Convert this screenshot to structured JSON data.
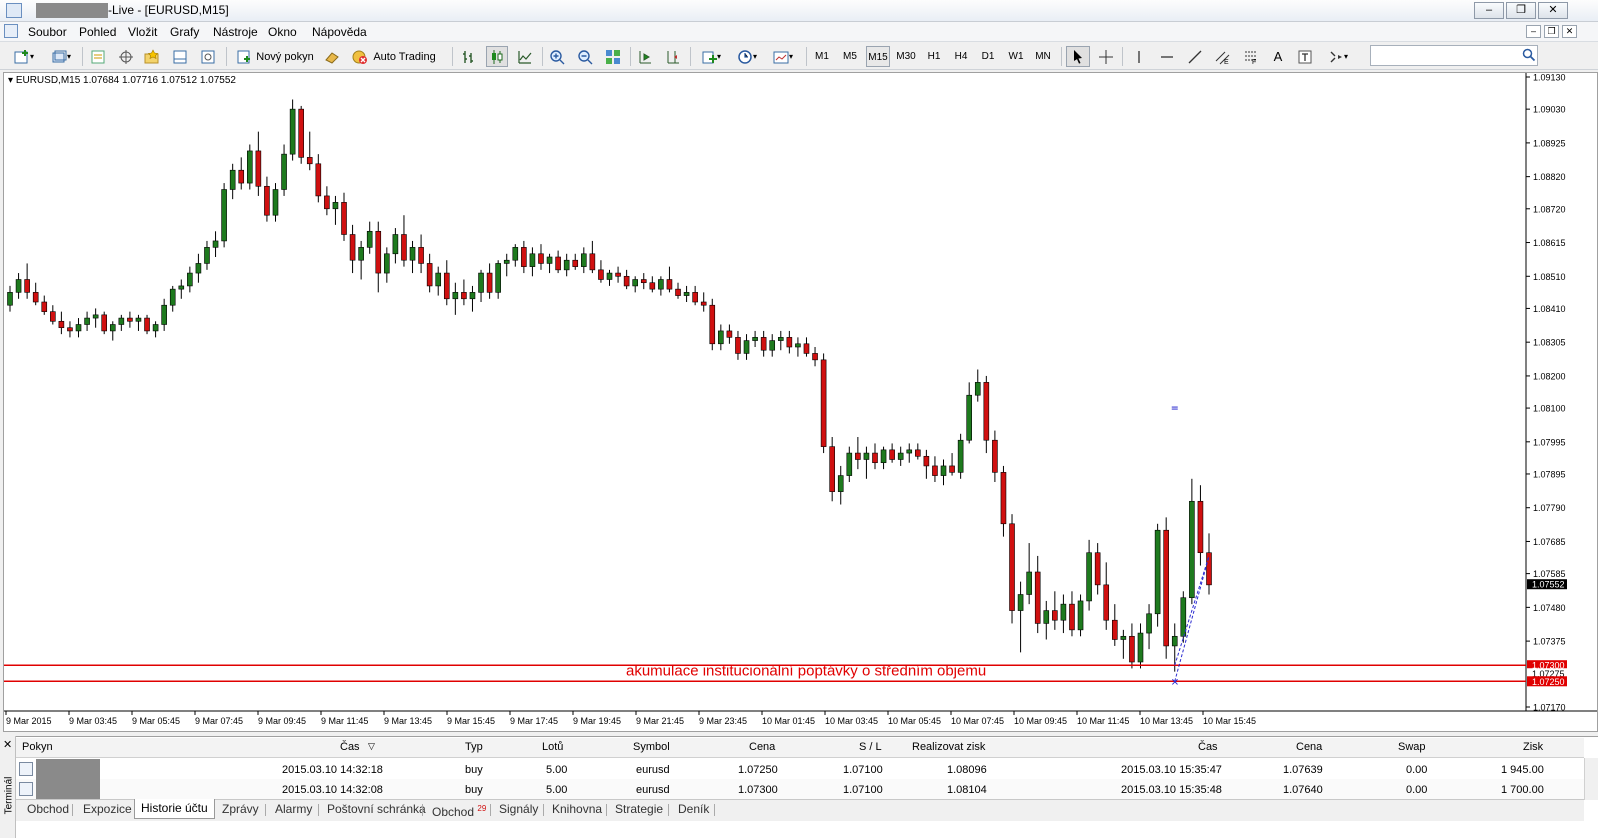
{
  "window": {
    "title": "-Live - [EURUSD,M15]",
    "buttons": [
      "–",
      "❐",
      "✕"
    ]
  },
  "menu": {
    "items": [
      "Soubor",
      "Pohled",
      "Vložit",
      "Grafy",
      "Nástroje",
      "Okno",
      "Nápověda"
    ]
  },
  "toolbar": {
    "new_order": "Nový pokyn",
    "auto_trading": "Auto Trading",
    "timeframes": [
      "M1",
      "M5",
      "M15",
      "M30",
      "H1",
      "H4",
      "D1",
      "W1",
      "MN"
    ],
    "active_timeframe": "M15",
    "text_tool": "A"
  },
  "chart": {
    "symbol_line": "EURUSD,M15  1.07684 1.07716 1.07512 1.07552",
    "annotation": "akumulace institucionální poptávky o středním objemu",
    "price_labels": [
      "1.09130",
      "1.09030",
      "1.08925",
      "1.08820",
      "1.08720",
      "1.08615",
      "1.08510",
      "1.08410",
      "1.08305",
      "1.08200",
      "1.08100",
      "1.07995",
      "1.07895",
      "1.07790",
      "1.07685",
      "1.07585",
      "1.07480",
      "1.07375",
      "1.07170"
    ],
    "current_price": "1.07552",
    "line_labels": [
      "1.07300",
      "1.07275",
      "1.07250"
    ],
    "time_labels": [
      "9 Mar 2015",
      "9 Mar 03:45",
      "9 Mar 05:45",
      "9 Mar 07:45",
      "9 Mar 09:45",
      "9 Mar 11:45",
      "9 Mar 13:45",
      "9 Mar 15:45",
      "9 Mar 17:45",
      "9 Mar 19:45",
      "9 Mar 21:45",
      "9 Mar 23:45",
      "10 Mar 01:45",
      "10 Mar 03:45",
      "10 Mar 05:45",
      "10 Mar 07:45",
      "10 Mar 09:45",
      "10 Mar 11:45",
      "10 Mar 13:45",
      "10 Mar 15:45"
    ],
    "colors": {
      "bull": "#1e7a1e",
      "bear": "#d01010",
      "line": "#e00000",
      "label_bg": "#e00000",
      "current_bg": "#000000"
    }
  },
  "chart_data": {
    "type": "candlestick",
    "symbol": "EURUSD",
    "timeframe": "M15",
    "ohlc": [
      [
        1.0842,
        1.0848,
        1.084,
        1.0846
      ],
      [
        1.0846,
        1.0852,
        1.0844,
        1.085
      ],
      [
        1.085,
        1.0855,
        1.0844,
        1.0846
      ],
      [
        1.0846,
        1.0849,
        1.0842,
        1.0843
      ],
      [
        1.0843,
        1.0845,
        1.0839,
        1.084
      ],
      [
        1.084,
        1.0842,
        1.0836,
        1.0837
      ],
      [
        1.0837,
        1.084,
        1.0833,
        1.0835
      ],
      [
        1.0835,
        1.0837,
        1.0832,
        1.0834
      ],
      [
        1.0834,
        1.0838,
        1.0832,
        1.0836
      ],
      [
        1.0836,
        1.084,
        1.0834,
        1.0838
      ],
      [
        1.0838,
        1.0841,
        1.0835,
        1.0839
      ],
      [
        1.0839,
        1.084,
        1.0833,
        1.0834
      ],
      [
        1.0834,
        1.0837,
        1.0831,
        1.0836
      ],
      [
        1.0836,
        1.0839,
        1.0834,
        1.0838
      ],
      [
        1.0838,
        1.084,
        1.0835,
        1.0837
      ],
      [
        1.0837,
        1.0839,
        1.0834,
        1.0838
      ],
      [
        1.0838,
        1.0839,
        1.0833,
        1.0834
      ],
      [
        1.0834,
        1.0837,
        1.0832,
        1.0836
      ],
      [
        1.0836,
        1.0844,
        1.0834,
        1.0842
      ],
      [
        1.0842,
        1.0848,
        1.084,
        1.0847
      ],
      [
        1.0847,
        1.085,
        1.0844,
        1.0848
      ],
      [
        1.0848,
        1.0854,
        1.0846,
        1.0852
      ],
      [
        1.0852,
        1.0858,
        1.0849,
        1.0855
      ],
      [
        1.0855,
        1.0862,
        1.0853,
        1.086
      ],
      [
        1.086,
        1.0865,
        1.0857,
        1.0862
      ],
      [
        1.0862,
        1.088,
        1.086,
        1.0878
      ],
      [
        1.0878,
        1.0886,
        1.0875,
        1.0884
      ],
      [
        1.0884,
        1.0888,
        1.0878,
        1.088
      ],
      [
        1.088,
        1.0892,
        1.0878,
        1.089
      ],
      [
        1.089,
        1.0896,
        1.0876,
        1.0879
      ],
      [
        1.0879,
        1.0882,
        1.0868,
        1.087
      ],
      [
        1.087,
        1.088,
        1.0868,
        1.0878
      ],
      [
        1.0878,
        1.0892,
        1.0876,
        1.0889
      ],
      [
        1.0889,
        1.0906,
        1.0887,
        1.0903
      ],
      [
        1.0903,
        1.0904,
        1.0886,
        1.0888
      ],
      [
        1.0888,
        1.0896,
        1.0884,
        1.0886
      ],
      [
        1.0886,
        1.0889,
        1.0874,
        1.0876
      ],
      [
        1.0876,
        1.0879,
        1.087,
        1.0872
      ],
      [
        1.0872,
        1.0876,
        1.0867,
        1.0874
      ],
      [
        1.0874,
        1.0877,
        1.0862,
        1.0864
      ],
      [
        1.0864,
        1.0867,
        1.0852,
        1.0856
      ],
      [
        1.0856,
        1.0862,
        1.085,
        1.086
      ],
      [
        1.086,
        1.0868,
        1.0858,
        1.0865
      ],
      [
        1.0865,
        1.0868,
        1.0846,
        1.0852
      ],
      [
        1.0852,
        1.086,
        1.0849,
        1.0858
      ],
      [
        1.0858,
        1.0866,
        1.0855,
        1.0864
      ],
      [
        1.0864,
        1.087,
        1.0854,
        1.0856
      ],
      [
        1.0856,
        1.0862,
        1.0852,
        1.086
      ],
      [
        1.086,
        1.0864,
        1.0852,
        1.0855
      ],
      [
        1.0855,
        1.0858,
        1.0846,
        1.0848
      ],
      [
        1.0848,
        1.0854,
        1.0845,
        1.0852
      ],
      [
        1.0852,
        1.0856,
        1.0842,
        1.0844
      ],
      [
        1.0844,
        1.0849,
        1.0839,
        1.0846
      ],
      [
        1.0846,
        1.085,
        1.0842,
        1.0844
      ],
      [
        1.0844,
        1.0848,
        1.084,
        1.0846
      ],
      [
        1.0846,
        1.0853,
        1.0843,
        1.0852
      ],
      [
        1.0852,
        1.0855,
        1.0844,
        1.0846
      ],
      [
        1.0846,
        1.0856,
        1.0844,
        1.0855
      ],
      [
        1.0855,
        1.0858,
        1.0851,
        1.0856
      ],
      [
        1.0856,
        1.0861,
        1.0854,
        1.086
      ],
      [
        1.086,
        1.0862,
        1.0852,
        1.0854
      ],
      [
        1.0854,
        1.086,
        1.0851,
        1.0858
      ],
      [
        1.0858,
        1.0861,
        1.0853,
        1.0855
      ],
      [
        1.0855,
        1.0858,
        1.0852,
        1.0857
      ],
      [
        1.0857,
        1.0859,
        1.0852,
        1.0853
      ],
      [
        1.0853,
        1.0858,
        1.0851,
        1.0856
      ],
      [
        1.0856,
        1.0858,
        1.0853,
        1.0854
      ],
      [
        1.0854,
        1.086,
        1.0852,
        1.0858
      ],
      [
        1.0858,
        1.0862,
        1.0852,
        1.0853
      ],
      [
        1.0853,
        1.0856,
        1.0849,
        1.085
      ],
      [
        1.085,
        1.0853,
        1.0848,
        1.0852
      ],
      [
        1.0852,
        1.0854,
        1.0849,
        1.0851
      ],
      [
        1.0851,
        1.0853,
        1.0847,
        1.0848
      ],
      [
        1.0848,
        1.0851,
        1.0846,
        1.085
      ],
      [
        1.085,
        1.0852,
        1.0847,
        1.0849
      ],
      [
        1.0849,
        1.0851,
        1.0846,
        1.0847
      ],
      [
        1.0847,
        1.0851,
        1.0845,
        1.085
      ],
      [
        1.085,
        1.0854,
        1.0846,
        1.0847
      ],
      [
        1.0847,
        1.0849,
        1.0844,
        1.0845
      ],
      [
        1.0845,
        1.0848,
        1.0843,
        1.0846
      ],
      [
        1.0846,
        1.0848,
        1.0842,
        1.0843
      ],
      [
        1.0843,
        1.0846,
        1.084,
        1.0842
      ],
      [
        1.0842,
        1.0844,
        1.0828,
        1.083
      ],
      [
        1.083,
        1.0836,
        1.0828,
        1.0834
      ],
      [
        1.0834,
        1.0836,
        1.083,
        1.0832
      ],
      [
        1.0832,
        1.0834,
        1.0825,
        1.0827
      ],
      [
        1.0827,
        1.0833,
        1.0825,
        1.0831
      ],
      [
        1.0831,
        1.0834,
        1.0829,
        1.0832
      ],
      [
        1.0832,
        1.0834,
        1.0826,
        1.0828
      ],
      [
        1.0828,
        1.0833,
        1.0826,
        1.0831
      ],
      [
        1.0831,
        1.0834,
        1.0828,
        1.0832
      ],
      [
        1.0832,
        1.0834,
        1.0827,
        1.0829
      ],
      [
        1.0829,
        1.0832,
        1.0826,
        1.083
      ],
      [
        1.083,
        1.0832,
        1.0826,
        1.0827
      ],
      [
        1.0827,
        1.0829,
        1.0823,
        1.0825
      ],
      [
        1.0825,
        1.0827,
        1.0796,
        1.0798
      ],
      [
        1.0798,
        1.0801,
        1.0781,
        1.0784
      ],
      [
        1.0784,
        1.0792,
        1.078,
        1.0789
      ],
      [
        1.0789,
        1.0798,
        1.0787,
        1.0796
      ],
      [
        1.0796,
        1.0801,
        1.0791,
        1.0794
      ],
      [
        1.0794,
        1.0798,
        1.0788,
        1.0796
      ],
      [
        1.0796,
        1.0799,
        1.0791,
        1.0793
      ],
      [
        1.0793,
        1.0798,
        1.0791,
        1.0797
      ],
      [
        1.0797,
        1.0799,
        1.0793,
        1.0794
      ],
      [
        1.0794,
        1.0798,
        1.0792,
        1.0796
      ],
      [
        1.0796,
        1.0799,
        1.0793,
        1.0797
      ],
      [
        1.0797,
        1.0799,
        1.0794,
        1.0795
      ],
      [
        1.0795,
        1.0797,
        1.0788,
        1.0792
      ],
      [
        1.0792,
        1.0795,
        1.0787,
        1.0789
      ],
      [
        1.0789,
        1.0794,
        1.0786,
        1.0792
      ],
      [
        1.0792,
        1.0796,
        1.0789,
        1.079
      ],
      [
        1.079,
        1.0802,
        1.0788,
        1.08
      ],
      [
        1.08,
        1.0818,
        1.0799,
        1.0814
      ],
      [
        1.0814,
        1.0822,
        1.0812,
        1.0818
      ],
      [
        1.0818,
        1.082,
        1.0796,
        1.08
      ],
      [
        1.08,
        1.0803,
        1.0787,
        1.079
      ],
      [
        1.079,
        1.0792,
        1.077,
        1.0774
      ],
      [
        1.0774,
        1.0777,
        1.0743,
        1.0747
      ],
      [
        1.0747,
        1.0756,
        1.0734,
        1.0752
      ],
      [
        1.0752,
        1.0768,
        1.0749,
        1.0759
      ],
      [
        1.0759,
        1.0764,
        1.074,
        1.0743
      ],
      [
        1.0743,
        1.075,
        1.0738,
        1.0747
      ],
      [
        1.0747,
        1.0753,
        1.0741,
        1.0744
      ],
      [
        1.0744,
        1.0752,
        1.074,
        1.0749
      ],
      [
        1.0749,
        1.0753,
        1.0739,
        1.0741
      ],
      [
        1.0741,
        1.0752,
        1.0739,
        1.075
      ],
      [
        1.075,
        1.0769,
        1.0747,
        1.0765
      ],
      [
        1.0765,
        1.0768,
        1.0752,
        1.0755
      ],
      [
        1.0755,
        1.0762,
        1.0741,
        1.0744
      ],
      [
        1.0744,
        1.0749,
        1.0736,
        1.0738
      ],
      [
        1.0738,
        1.0741,
        1.0732,
        1.0739
      ],
      [
        1.0739,
        1.0743,
        1.0729,
        1.0731
      ],
      [
        1.0731,
        1.0743,
        1.0729,
        1.074
      ],
      [
        1.074,
        1.0749,
        1.0735,
        1.0746
      ],
      [
        1.0746,
        1.0774,
        1.0742,
        1.0772
      ],
      [
        1.0772,
        1.0776,
        1.0732,
        1.0736
      ],
      [
        1.0736,
        1.0743,
        1.0728,
        1.0739
      ],
      [
        1.0739,
        1.0753,
        1.0737,
        1.0751
      ],
      [
        1.0751,
        1.0788,
        1.0749,
        1.0781
      ],
      [
        1.0781,
        1.0786,
        1.0761,
        1.0765
      ],
      [
        1.0765,
        1.0771,
        1.0752,
        1.0755
      ]
    ],
    "price_range": [
      1.0717,
      1.0913
    ],
    "horizontal_lines": [
      1.073,
      1.0725
    ],
    "annotation": "akumulace institucionální poptávky o středním objemu",
    "current_price": 1.07552
  },
  "terminal": {
    "side_label": "Terminál",
    "close": "✕",
    "columns": [
      "Pokyn",
      "Čas",
      "Typ",
      "Lotů",
      "Symbol",
      "Cena",
      "S / L",
      "Realizovat zisk",
      "Čas",
      "Cena",
      "Swap",
      "Zisk"
    ],
    "sort_marker": "▽",
    "rows": [
      {
        "open_time": "2015.03.10 14:32:18",
        "type": "buy",
        "lots": "5.00",
        "symbol": "eurusd",
        "price": "1.07250",
        "sl": "1.07100",
        "tp": "1.08096",
        "close_time": "2015.03.10 15:35:47",
        "close_price": "1.07639",
        "swap": "0.00",
        "profit": "1 945.00"
      },
      {
        "open_time": "2015.03.10 14:32:08",
        "type": "buy",
        "lots": "5.00",
        "symbol": "eurusd",
        "price": "1.07300",
        "sl": "1.07100",
        "tp": "1.08104",
        "close_time": "2015.03.10 15:35:48",
        "close_price": "1.07640",
        "swap": "0.00",
        "profit": "1 700.00"
      }
    ],
    "tabs": [
      "Obchod",
      "Expozice",
      "Historie účtu",
      "Zprávy",
      "Alarmy",
      "Poštovní schránka",
      "Obchod",
      "Signály",
      "Knihovna",
      "Strategie",
      "Deník"
    ],
    "tab_badge": "29",
    "active_tab": "Historie účtu"
  }
}
